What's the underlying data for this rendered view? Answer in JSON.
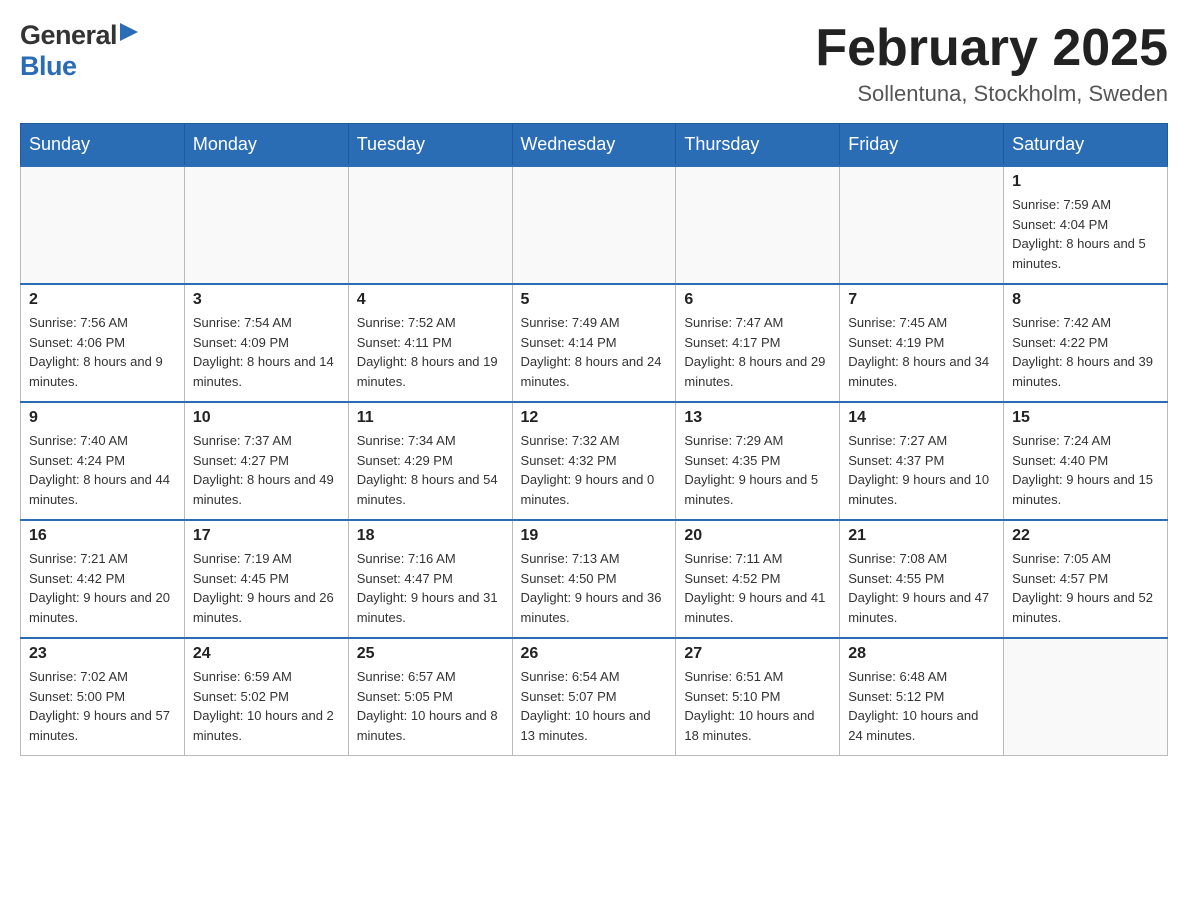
{
  "header": {
    "logo": {
      "general": "General",
      "blue": "Blue"
    },
    "month": "February 2025",
    "location": "Sollentuna, Stockholm, Sweden"
  },
  "weekdays": [
    "Sunday",
    "Monday",
    "Tuesday",
    "Wednesday",
    "Thursday",
    "Friday",
    "Saturday"
  ],
  "weeks": [
    [
      {
        "day": "",
        "info": ""
      },
      {
        "day": "",
        "info": ""
      },
      {
        "day": "",
        "info": ""
      },
      {
        "day": "",
        "info": ""
      },
      {
        "day": "",
        "info": ""
      },
      {
        "day": "",
        "info": ""
      },
      {
        "day": "1",
        "info": "Sunrise: 7:59 AM\nSunset: 4:04 PM\nDaylight: 8 hours and 5 minutes."
      }
    ],
    [
      {
        "day": "2",
        "info": "Sunrise: 7:56 AM\nSunset: 4:06 PM\nDaylight: 8 hours and 9 minutes."
      },
      {
        "day": "3",
        "info": "Sunrise: 7:54 AM\nSunset: 4:09 PM\nDaylight: 8 hours and 14 minutes."
      },
      {
        "day": "4",
        "info": "Sunrise: 7:52 AM\nSunset: 4:11 PM\nDaylight: 8 hours and 19 minutes."
      },
      {
        "day": "5",
        "info": "Sunrise: 7:49 AM\nSunset: 4:14 PM\nDaylight: 8 hours and 24 minutes."
      },
      {
        "day": "6",
        "info": "Sunrise: 7:47 AM\nSunset: 4:17 PM\nDaylight: 8 hours and 29 minutes."
      },
      {
        "day": "7",
        "info": "Sunrise: 7:45 AM\nSunset: 4:19 PM\nDaylight: 8 hours and 34 minutes."
      },
      {
        "day": "8",
        "info": "Sunrise: 7:42 AM\nSunset: 4:22 PM\nDaylight: 8 hours and 39 minutes."
      }
    ],
    [
      {
        "day": "9",
        "info": "Sunrise: 7:40 AM\nSunset: 4:24 PM\nDaylight: 8 hours and 44 minutes."
      },
      {
        "day": "10",
        "info": "Sunrise: 7:37 AM\nSunset: 4:27 PM\nDaylight: 8 hours and 49 minutes."
      },
      {
        "day": "11",
        "info": "Sunrise: 7:34 AM\nSunset: 4:29 PM\nDaylight: 8 hours and 54 minutes."
      },
      {
        "day": "12",
        "info": "Sunrise: 7:32 AM\nSunset: 4:32 PM\nDaylight: 9 hours and 0 minutes."
      },
      {
        "day": "13",
        "info": "Sunrise: 7:29 AM\nSunset: 4:35 PM\nDaylight: 9 hours and 5 minutes."
      },
      {
        "day": "14",
        "info": "Sunrise: 7:27 AM\nSunset: 4:37 PM\nDaylight: 9 hours and 10 minutes."
      },
      {
        "day": "15",
        "info": "Sunrise: 7:24 AM\nSunset: 4:40 PM\nDaylight: 9 hours and 15 minutes."
      }
    ],
    [
      {
        "day": "16",
        "info": "Sunrise: 7:21 AM\nSunset: 4:42 PM\nDaylight: 9 hours and 20 minutes."
      },
      {
        "day": "17",
        "info": "Sunrise: 7:19 AM\nSunset: 4:45 PM\nDaylight: 9 hours and 26 minutes."
      },
      {
        "day": "18",
        "info": "Sunrise: 7:16 AM\nSunset: 4:47 PM\nDaylight: 9 hours and 31 minutes."
      },
      {
        "day": "19",
        "info": "Sunrise: 7:13 AM\nSunset: 4:50 PM\nDaylight: 9 hours and 36 minutes."
      },
      {
        "day": "20",
        "info": "Sunrise: 7:11 AM\nSunset: 4:52 PM\nDaylight: 9 hours and 41 minutes."
      },
      {
        "day": "21",
        "info": "Sunrise: 7:08 AM\nSunset: 4:55 PM\nDaylight: 9 hours and 47 minutes."
      },
      {
        "day": "22",
        "info": "Sunrise: 7:05 AM\nSunset: 4:57 PM\nDaylight: 9 hours and 52 minutes."
      }
    ],
    [
      {
        "day": "23",
        "info": "Sunrise: 7:02 AM\nSunset: 5:00 PM\nDaylight: 9 hours and 57 minutes."
      },
      {
        "day": "24",
        "info": "Sunrise: 6:59 AM\nSunset: 5:02 PM\nDaylight: 10 hours and 2 minutes."
      },
      {
        "day": "25",
        "info": "Sunrise: 6:57 AM\nSunset: 5:05 PM\nDaylight: 10 hours and 8 minutes."
      },
      {
        "day": "26",
        "info": "Sunrise: 6:54 AM\nSunset: 5:07 PM\nDaylight: 10 hours and 13 minutes."
      },
      {
        "day": "27",
        "info": "Sunrise: 6:51 AM\nSunset: 5:10 PM\nDaylight: 10 hours and 18 minutes."
      },
      {
        "day": "28",
        "info": "Sunrise: 6:48 AM\nSunset: 5:12 PM\nDaylight: 10 hours and 24 minutes."
      },
      {
        "day": "",
        "info": ""
      }
    ]
  ]
}
